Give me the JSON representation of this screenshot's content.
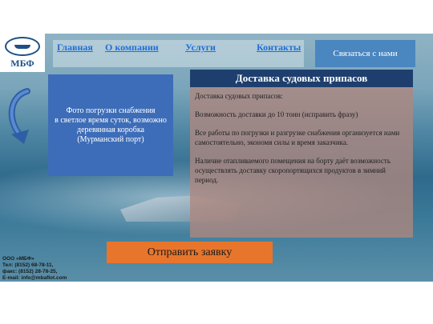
{
  "logo": {
    "text": "МБФ"
  },
  "nav": {
    "items": [
      {
        "label": "Главная"
      },
      {
        "label": "О компании"
      },
      {
        "label": "Услуги"
      },
      {
        "label": "Контакты"
      }
    ],
    "contact_label": "Связаться  с нами"
  },
  "photo_placeholder": {
    "text": "Фото погрузки снабжения\nв светлое время суток, возможно деревянная коробка\n(Мурманский порт)"
  },
  "card": {
    "title": "Доставка судовых припасов",
    "paragraphs": [
      "Доставка судовых припасов:",
      "Возможность доставки до 10 тонн (исправить фразу)",
      "Все работы по погрузки и разгрузке снабжения организуется нами самостоятельно, экономя силы и время заказчика.",
      "Наличие отапливаемого помещения на борту даёт возможность осуществлять доставку скоропортящихся продуктов в зимний период."
    ]
  },
  "send_button": {
    "label": "Отправить заявку"
  },
  "footer": {
    "company": "ООО «МБФ»",
    "phone": "Тел: (8152) 68-78-11,",
    "fax": "факс: (8152) 28-78-25,",
    "email": "E-mail: info@mbaflot.com"
  },
  "colors": {
    "nav_link": "#1d6fd8",
    "contact_button": "#4a86c0",
    "photo_box": "#3d6db8",
    "card_title_bg": "#1e3f6e",
    "send_button": "#e8752c",
    "logo": "#1d4f86"
  }
}
